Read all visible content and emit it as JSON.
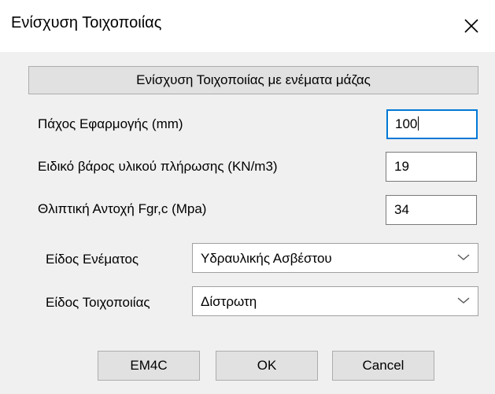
{
  "window": {
    "title": "Ενίσχυση Τοιχοποιίας"
  },
  "banner": "Ενίσχυση Τοιχοποιίας με ενέματα μάζας",
  "fields": [
    {
      "label": "Πάχος Εφαρμογής (mm)",
      "value": "100"
    },
    {
      "label": "Ειδικό βάρος υλικού πλήρωσης (KN/m3)",
      "value": "19"
    },
    {
      "label": "Θλιπτική Αντοχή Fgr,c (Mpa)",
      "value": "34"
    }
  ],
  "dropdowns": [
    {
      "label": "Είδος Ενέματος",
      "selected": "Υδραυλικής Ασβέστου"
    },
    {
      "label": "Είδος Τοιχοποιίας",
      "selected": "Δίστρωτη"
    }
  ],
  "buttons": {
    "em4c": "EM4C",
    "ok": "OK",
    "cancel": "Cancel"
  },
  "icons": {
    "close": "close-icon",
    "dropdown": "chevron-down-icon"
  },
  "colors": {
    "focus_border": "#0078d7",
    "button_face": "#e1e1e1",
    "dialog_bg": "#f0f0f0"
  }
}
